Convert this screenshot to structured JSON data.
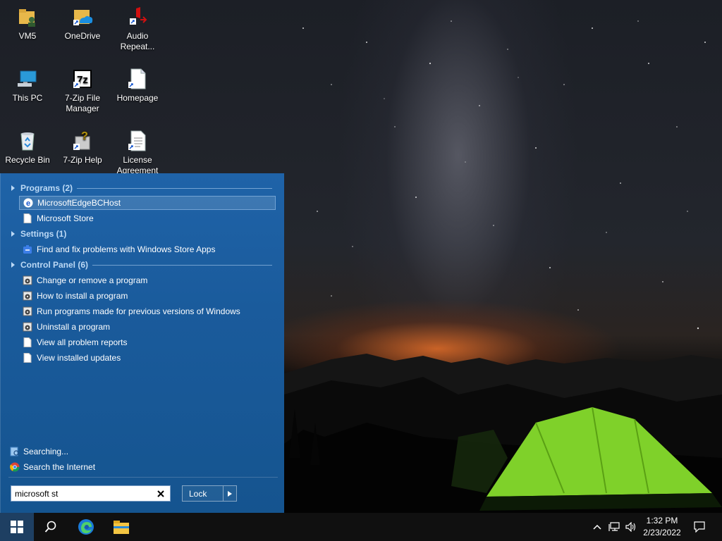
{
  "desktop": {
    "icons": [
      {
        "label": "VM5"
      },
      {
        "label": "OneDrive"
      },
      {
        "label": "Audio Repeat..."
      },
      {
        "label": "This PC"
      },
      {
        "label": "7-Zip File Manager"
      },
      {
        "label": "Homepage"
      },
      {
        "label": "Recycle Bin"
      },
      {
        "label": "7-Zip Help"
      },
      {
        "label": "License Agreement"
      }
    ]
  },
  "start_menu": {
    "sections": [
      {
        "header": "Programs (2)",
        "items": [
          {
            "label": "MicrosoftEdgeBCHost",
            "icon": "edge-icon",
            "selected": true
          },
          {
            "label": "Microsoft Store",
            "icon": "document-icon"
          }
        ]
      },
      {
        "header": "Settings (1)",
        "items": [
          {
            "label": "Find and fix problems with Windows Store Apps",
            "icon": "troubleshoot-icon"
          }
        ]
      },
      {
        "header": "Control Panel (6)",
        "items": [
          {
            "label": "Change or remove a program",
            "icon": "programs-icon"
          },
          {
            "label": "How to install a program",
            "icon": "programs-icon"
          },
          {
            "label": "Run programs made for previous versions of Windows",
            "icon": "programs-icon"
          },
          {
            "label": "Uninstall a program",
            "icon": "programs-icon"
          },
          {
            "label": "View all problem reports",
            "icon": "document-icon"
          },
          {
            "label": "View installed updates",
            "icon": "document-icon"
          }
        ]
      }
    ],
    "searching_label": "Searching...",
    "search_internet_label": "Search the Internet",
    "search_value": "microsoft st",
    "lock_label": "Lock"
  },
  "taskbar": {
    "time": "1:32 PM",
    "date": "2/23/2022"
  },
  "colors": {
    "start_menu_bg": "#1a5b9c",
    "section_header": "#bcd9f5",
    "taskbar_bg": "#101010"
  }
}
